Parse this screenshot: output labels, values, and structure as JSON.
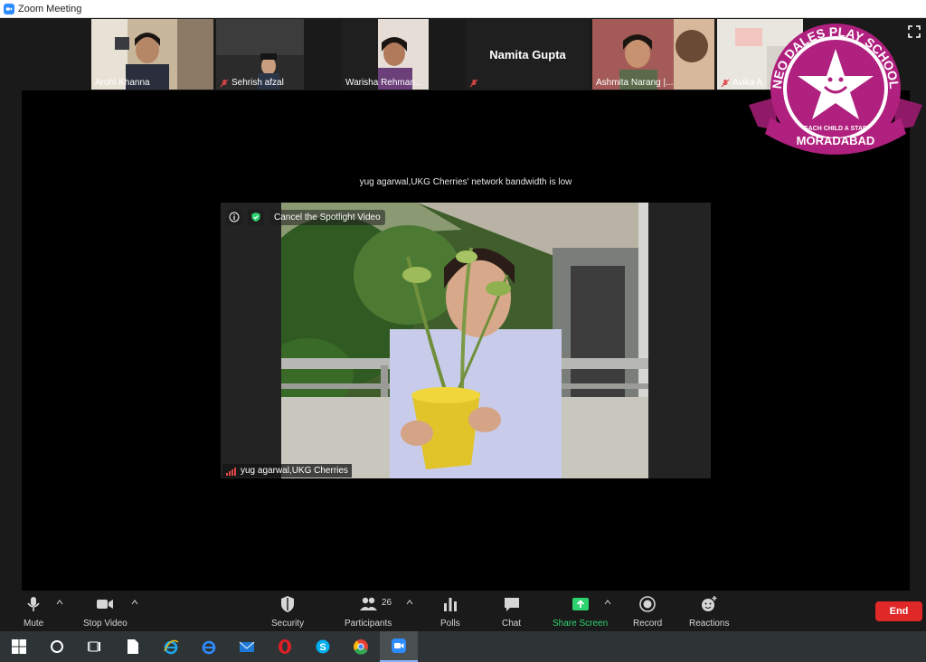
{
  "window": {
    "title": "Zoom Meeting"
  },
  "thumbnails": [
    {
      "name": "Arohi Khanna",
      "muted": false
    },
    {
      "name": "Sehrish afzal",
      "muted": true
    },
    {
      "name": "Warisha Rehman...",
      "muted": false
    },
    {
      "name": "Namita Gupta",
      "muted": true
    },
    {
      "name": "Ashmita Narang |...",
      "muted": false
    },
    {
      "name": "Avika A",
      "muted": true
    }
  ],
  "stage": {
    "bandwidth_message": "yug agarwal,UKG Cherries' network bandwidth is low",
    "spotlight_action": "Cancel the Spotlight Video",
    "speaker_label": "yug agarwal,UKG Cherries"
  },
  "badge": {
    "top_text": "NEO DALES PLAY SCHOOL",
    "tagline": "EACH CHILD A STAR",
    "bottom_text": "MORADABAD",
    "colors": {
      "primary": "#b0207e",
      "star": "#ffffff"
    }
  },
  "toolbar": {
    "mute": "Mute",
    "stop_video": "Stop Video",
    "security": "Security",
    "participants": "Participants",
    "participants_count": "26",
    "polls": "Polls",
    "chat": "Chat",
    "share_screen": "Share Screen",
    "record": "Record",
    "reactions": "Reactions",
    "end": "End",
    "colors": {
      "share": "#2dd36f",
      "end": "#e02828"
    }
  },
  "taskbar": {
    "items": [
      "windows-start",
      "search-circle",
      "task-view",
      "file",
      "internet-explorer",
      "edge-legacy",
      "mail",
      "opera",
      "skype",
      "chrome",
      "zoom"
    ]
  }
}
